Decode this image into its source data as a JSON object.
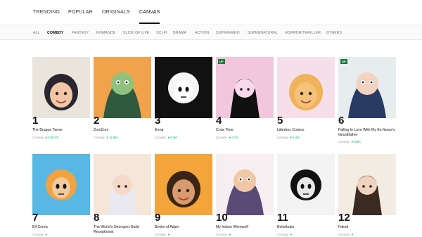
{
  "nav": {
    "tabs": [
      {
        "label": "TRENDING",
        "active": false
      },
      {
        "label": "POPULAR",
        "active": false
      },
      {
        "label": "ORIGINALS",
        "active": false
      },
      {
        "label": "CANVAS",
        "active": true
      }
    ]
  },
  "genres": [
    {
      "label": "ALL",
      "active": false
    },
    {
      "label": "COMEDY",
      "active": true
    },
    {
      "label": "FANTASY",
      "active": false
    },
    {
      "label": "ROMANCE",
      "active": false
    },
    {
      "label": "SLICE OF LIFE",
      "active": false
    },
    {
      "label": "SCI-FI",
      "active": false
    },
    {
      "label": "DRAMA",
      "active": false
    },
    {
      "label": "ACTION",
      "active": false
    },
    {
      "label": "SUPERHERO",
      "active": false
    },
    {
      "label": "SUPERNATURAL",
      "active": false
    },
    {
      "label": "HORROR/THRILLER",
      "active": false
    },
    {
      "label": "OTHERS",
      "active": false
    }
  ],
  "colors": {
    "accent": "#00c46a",
    "up_badge": "#1a7a3a"
  },
  "comics": [
    {
      "rank": "1",
      "title": "The Dragon Tamer",
      "genre": "Comedy",
      "likes": "676,078",
      "up": false,
      "art": "bg:#e9e4dc;fg:#2a2630;skin:#f1c7a6"
    },
    {
      "rank": "2",
      "title": "ZomCom",
      "genre": "Comedy",
      "likes": "11,664",
      "up": false,
      "art": "bg:#f1a34c;fg:#2f5a3e;skin:#8fc27c"
    },
    {
      "rank": "3",
      "title": "Erma",
      "genre": "Comedy",
      "likes": "6.9M",
      "up": false,
      "art": "bg:#111111;fg:#f5f5f5;skin:#ffffff"
    },
    {
      "rank": "4",
      "title": "Crow Time",
      "genre": "Comedy",
      "likes": "3.7M",
      "up": true,
      "art": "bg:#f2c6dc;fg:#101010;skin:#f7d9e9"
    },
    {
      "rank": "5",
      "title": "Litterbox Comics",
      "genre": "Comedy",
      "likes": "5.4M",
      "up": false,
      "art": "bg:#f7dfe9;fg:#f0b35a;skin:#f4c27a"
    },
    {
      "rank": "6",
      "title": "Falling In Love With My Ex-fiance's Grandfather",
      "genre": "Comedy",
      "likes": "506K",
      "up": true,
      "art": "bg:#e7ecef;fg:#293b63;skin:#f3d3c0"
    },
    {
      "rank": "7",
      "title": "Elf Comic",
      "genre": "Comedy",
      "likes": "",
      "up": false,
      "art": "bg:#59b7e4;fg:#f0a340;skin:#f1c99a"
    },
    {
      "rank": "8",
      "title": "The World's Strongest Guild Receptionist",
      "genre": "",
      "likes": "",
      "up": false,
      "art": "bg:#f4e6d8;fg:#e9e9ef;skin:#f6d8c6"
    },
    {
      "rank": "9",
      "title": "Books of Adam",
      "genre": "Comedy",
      "likes": "",
      "up": false,
      "art": "bg:#f3a53a;fg:#3a2416;skin:#d99a6c"
    },
    {
      "rank": "10",
      "title": "My Indoor Werewolf",
      "genre": "Comedy",
      "likes": "",
      "up": false,
      "art": "bg:#f7eef2;fg:#5a4a78;skin:#f2c7a3"
    },
    {
      "rank": "11",
      "title": "Belzebubs",
      "genre": "Comedy",
      "likes": "",
      "up": false,
      "art": "bg:#f3f3f3;fg:#111111;skin:#e8e8e8"
    },
    {
      "rank": "12",
      "title": "Faked",
      "genre": "Comedy",
      "likes": "",
      "up": false,
      "art": "bg:#f3ece3;fg:#3a2a22;skin:#f1d2bd"
    }
  ]
}
